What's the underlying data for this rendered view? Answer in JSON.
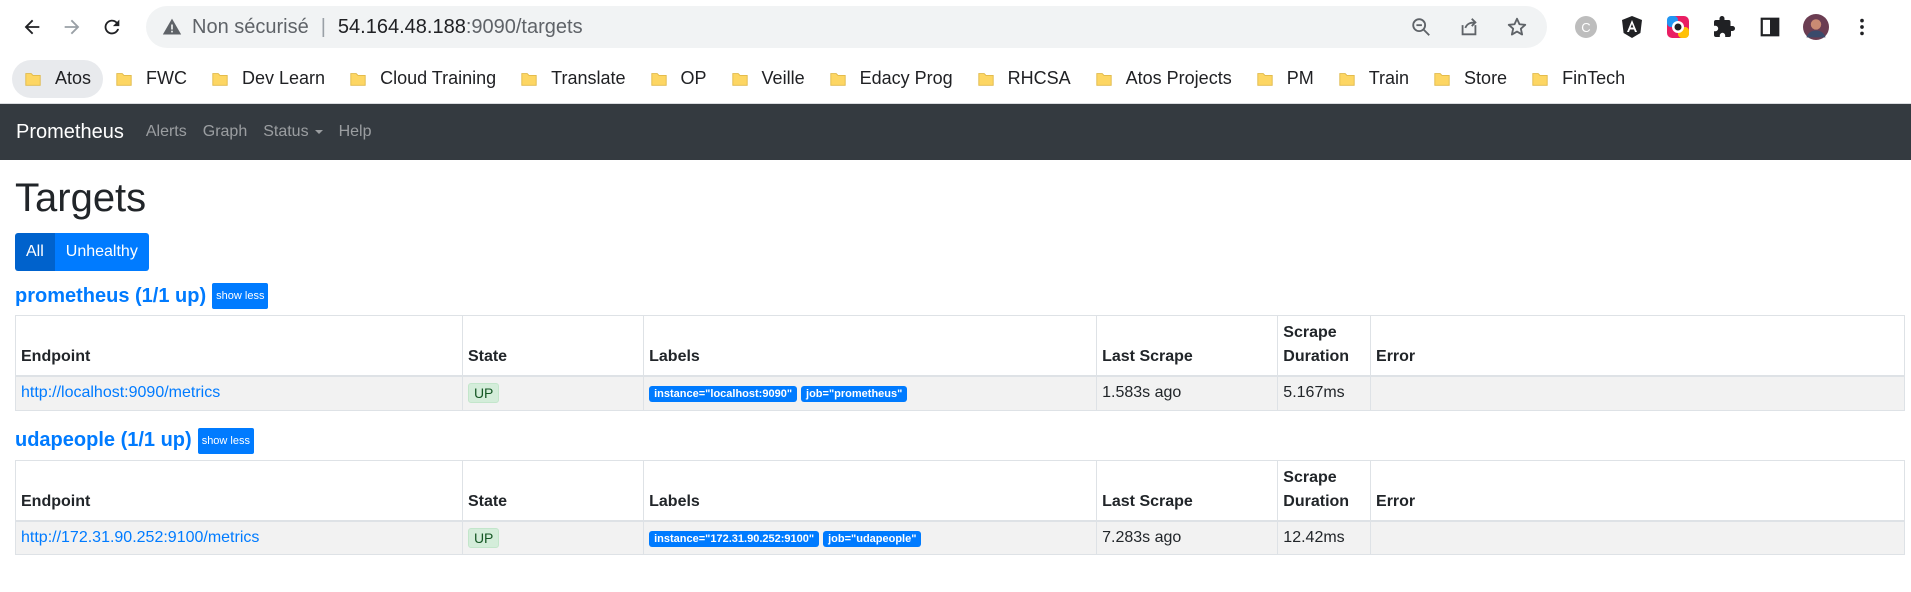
{
  "browser": {
    "insecure_label": "Non sécurisé",
    "url_host": "54.164.48.188",
    "url_path": ":9090/targets",
    "bookmarks": [
      "Atos",
      "FWC",
      "Dev Learn",
      "Cloud Training",
      "Translate",
      "OP",
      "Veille",
      "Edacy Prog",
      "RHCSA",
      "Atos Projects",
      "PM",
      "Train",
      "Store",
      "FinTech"
    ],
    "profile_letter": "C"
  },
  "navbar": {
    "brand": "Prometheus",
    "links": [
      "Alerts",
      "Graph",
      "Status",
      "Help"
    ]
  },
  "page": {
    "title": "Targets",
    "filters": [
      "All",
      "Unhealthy"
    ],
    "show_less": "show less",
    "columns": [
      "Endpoint",
      "State",
      "Labels",
      "Last Scrape",
      "Scrape Duration",
      "Error"
    ]
  },
  "jobs": [
    {
      "title": "prometheus (1/1 up)",
      "endpoint": "http://localhost:9090/metrics",
      "state": "UP",
      "labels": [
        "instance=\"localhost:9090\"",
        "job=\"prometheus\""
      ],
      "last_scrape": "1.583s ago",
      "duration": "5.167ms",
      "error": ""
    },
    {
      "title": "udapeople (1/1 up)",
      "endpoint": "http://172.31.90.252:9100/metrics",
      "state": "UP",
      "labels": [
        "instance=\"172.31.90.252:9100\"",
        "job=\"udapeople\""
      ],
      "last_scrape": "7.283s ago",
      "duration": "12.42ms",
      "error": ""
    }
  ]
}
